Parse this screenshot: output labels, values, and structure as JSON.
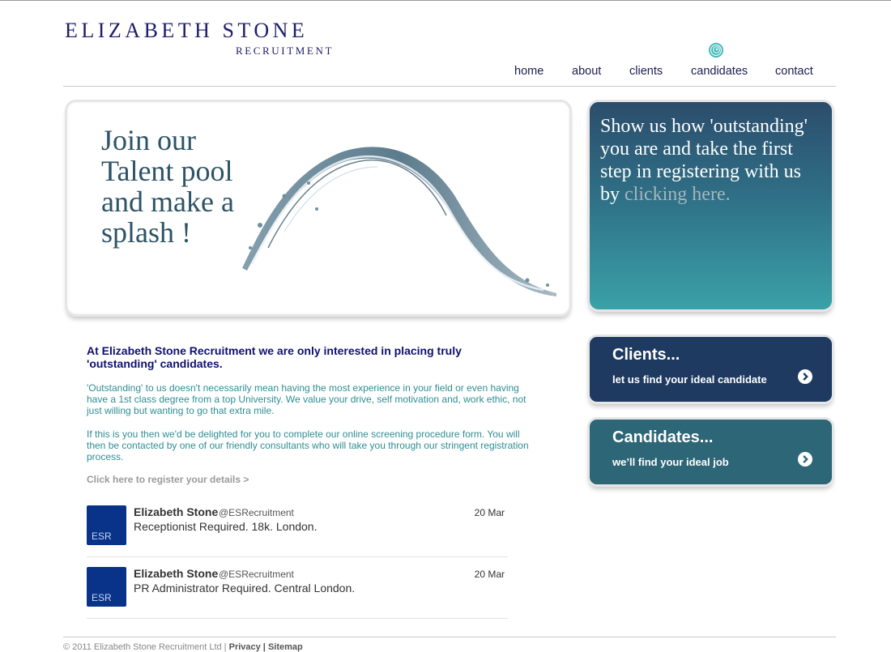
{
  "brand": {
    "name": "ELIZABETH STONE",
    "tagline": "RECRUITMENT"
  },
  "nav": {
    "items": [
      "home",
      "about",
      "clients",
      "candidates",
      "contact"
    ]
  },
  "hero": {
    "headline": "Join our Talent pool and make a splash !"
  },
  "promo": {
    "text": "Show us how 'outstanding' you are and take the first step in registering with us by",
    "link": "clicking here."
  },
  "cards": [
    {
      "title": "Clients...",
      "description": "let us find your ideal candidate",
      "color": "#1f3a60"
    },
    {
      "title": "Candidates...",
      "description": "we’ll find your ideal job",
      "color": "#2d6677"
    }
  ],
  "intro": {
    "heading": "At Elizabeth Stone Recruitment we are only interested in placing truly 'outstanding' candidates.",
    "paragraph1": "'Outstanding' to us doesn't necessarily mean having the most experience in your field or even having have a 1st class degree from a top University. We value your drive, self motivation and, work ethic, not just willing but wanting to go that extra mile.",
    "paragraph2": "If this is you then we'd be delighted for you to complete our online screening procedure form. You will then be contacted by one of our friendly consultants who will take you through our stringent registration process.",
    "register_link": "Click here to register your details >"
  },
  "tweets": [
    {
      "avatar": "ESR",
      "name": "Elizabeth Stone",
      "handle": "@ESRecruitment",
      "date": "20 Mar",
      "text": "Receptionist Required. 18k. London."
    },
    {
      "avatar": "ESR",
      "name": "Elizabeth Stone",
      "handle": "@ESRecruitment",
      "date": "20 Mar",
      "text": "PR Administrator Required. Central London."
    }
  ],
  "footer": {
    "text": "© 2011 Elizabeth Stone Recruitment Ltd |",
    "links": "Privacy | Sitemap"
  },
  "colors": {
    "brand_navy": "#1d1d6b",
    "accent_teal": "#2f8e93"
  }
}
